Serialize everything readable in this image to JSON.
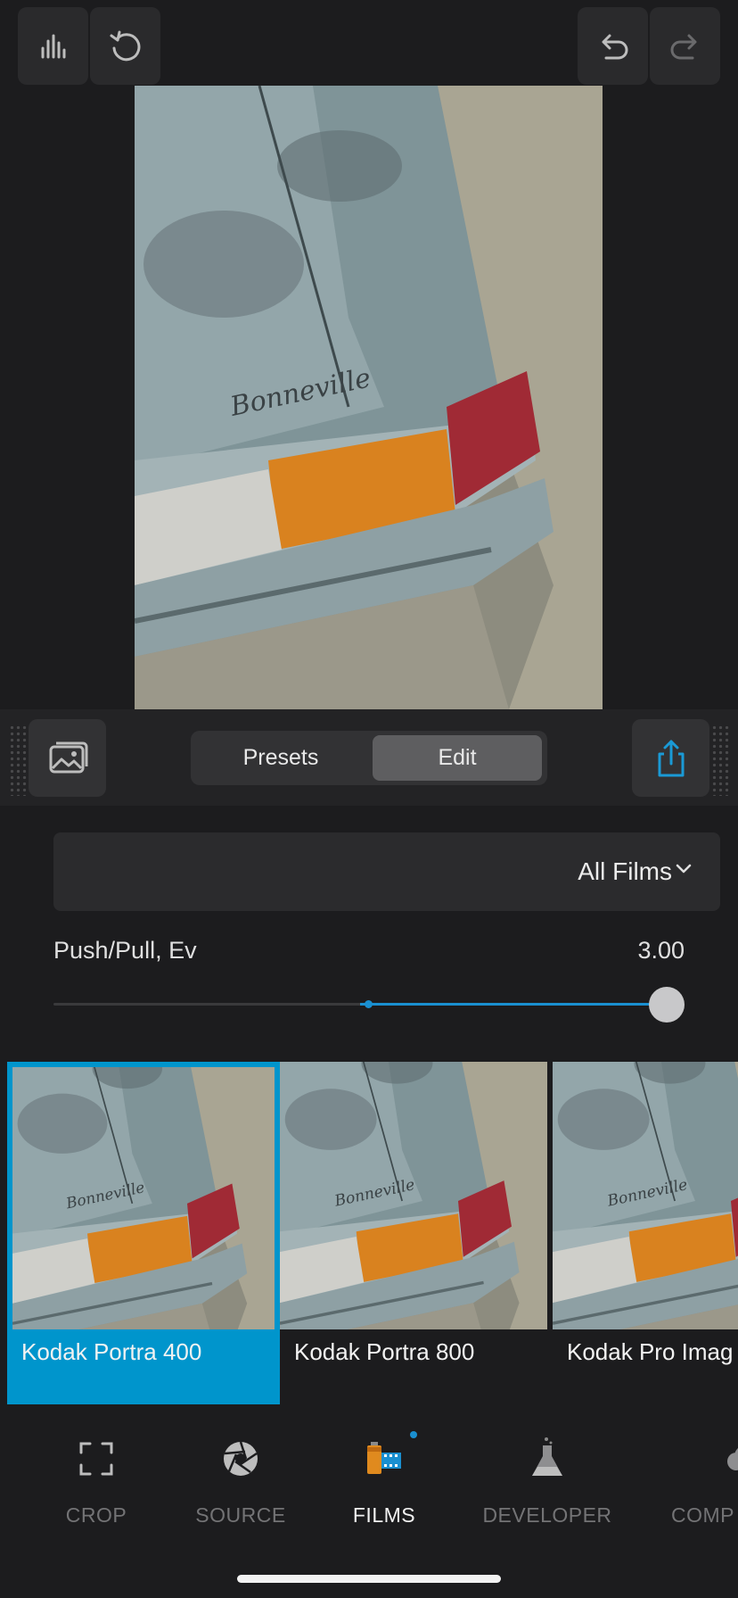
{
  "toolbar": {
    "histogram_icon": "histogram-icon",
    "reset_icon": "reset-icon",
    "undo_icon": "undo-icon",
    "redo_icon": "redo-icon"
  },
  "controls": {
    "gallery_icon": "gallery-icon",
    "share_icon": "share-icon",
    "segments": [
      "Presets",
      "Edit"
    ],
    "selected_segment": "Edit"
  },
  "filter": {
    "dropdown_label": "All Films"
  },
  "slider": {
    "label": "Push/Pull, Ev",
    "value": "3.00",
    "min": -3,
    "max": 3,
    "current": 3.0
  },
  "films": [
    {
      "name": "Kodak Portra 400",
      "selected": true
    },
    {
      "name": "Kodak Portra 800",
      "selected": false
    },
    {
      "name": "Kodak Pro Imag",
      "selected": false
    }
  ],
  "nav": [
    {
      "label": "CROP",
      "icon": "crop-icon",
      "active": false
    },
    {
      "label": "SOURCE",
      "icon": "aperture-icon",
      "active": false
    },
    {
      "label": "FILMS",
      "icon": "film-canister-icon",
      "active": true
    },
    {
      "label": "DEVELOPER",
      "icon": "flask-icon",
      "active": false
    },
    {
      "label": "COMP",
      "icon": "cloud-icon",
      "active": false
    }
  ],
  "colors": {
    "background": "#1c1c1e",
    "accent": "#0095cc",
    "button": "#2a2a2c"
  }
}
